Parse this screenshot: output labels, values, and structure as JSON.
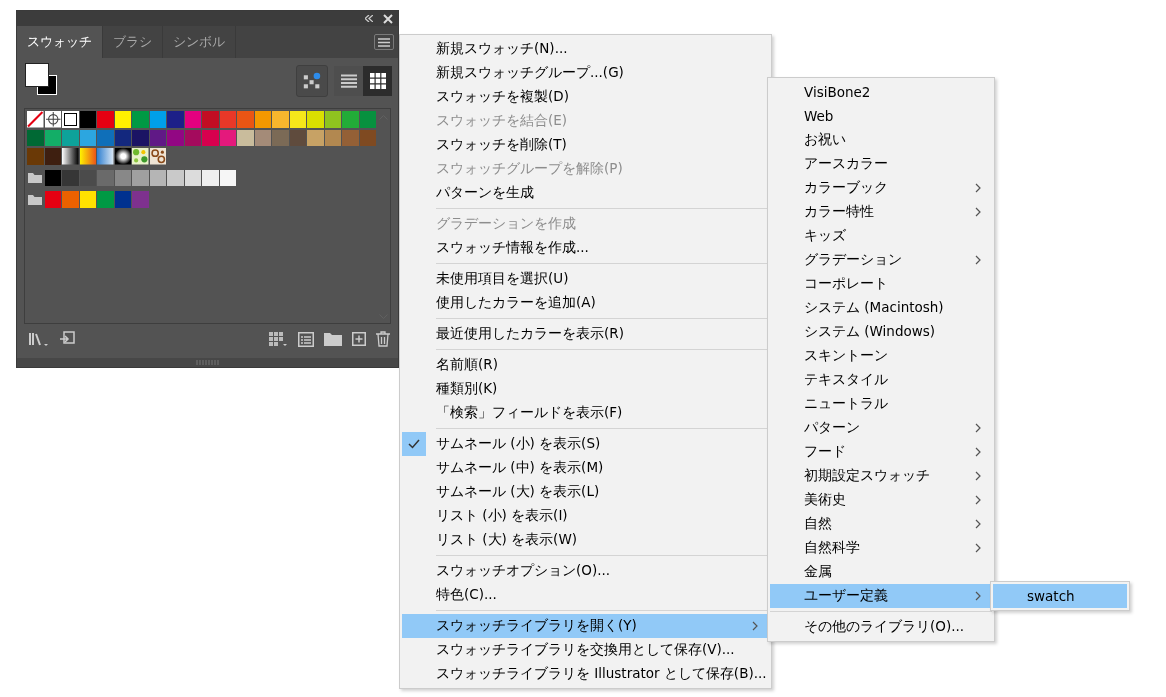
{
  "panel": {
    "tabs": [
      {
        "label": "スウォッチ",
        "selected": true
      },
      {
        "label": "ブラシ",
        "selected": false
      },
      {
        "label": "シンボル",
        "selected": false
      }
    ],
    "view_buttons": [
      {
        "kind": "list",
        "selected": false
      },
      {
        "kind": "grid",
        "selected": true
      }
    ],
    "swatch_rows": [
      {
        "kind": "plain",
        "swatches": [
          {
            "kind": "none"
          },
          {
            "kind": "registration"
          },
          {
            "kind": "solid",
            "color": "#ffffff"
          },
          {
            "kind": "solid",
            "color": "#000000"
          },
          {
            "kind": "solid",
            "color": "#e60012"
          },
          {
            "kind": "solid",
            "color": "#fff100"
          },
          {
            "kind": "solid",
            "color": "#009944"
          },
          {
            "kind": "solid",
            "color": "#00a0e9"
          },
          {
            "kind": "solid",
            "color": "#1d2088"
          },
          {
            "kind": "solid",
            "color": "#e4007f"
          },
          {
            "kind": "solid",
            "color": "#c30d23"
          },
          {
            "kind": "solid",
            "color": "#e83828"
          },
          {
            "kind": "solid",
            "color": "#ea5514"
          },
          {
            "kind": "solid",
            "color": "#f39800"
          },
          {
            "kind": "solid",
            "color": "#f8b62d"
          },
          {
            "kind": "solid",
            "color": "#f5e71a"
          },
          {
            "kind": "solid",
            "color": "#dadf00"
          },
          {
            "kind": "solid",
            "color": "#8fc31f"
          },
          {
            "kind": "solid",
            "color": "#22ac38"
          },
          {
            "kind": "solid",
            "color": "#07913f"
          }
        ]
      },
      {
        "kind": "plain",
        "swatches": [
          {
            "kind": "solid",
            "color": "#006934"
          },
          {
            "kind": "solid",
            "color": "#13ae67"
          },
          {
            "kind": "solid",
            "color": "#0ea29a"
          },
          {
            "kind": "solid",
            "color": "#2ca6e0"
          },
          {
            "kind": "solid",
            "color": "#0f6fb9"
          },
          {
            "kind": "solid",
            "color": "#13287e"
          },
          {
            "kind": "solid",
            "color": "#1b1464"
          },
          {
            "kind": "solid",
            "color": "#601986"
          },
          {
            "kind": "solid",
            "color": "#920783"
          },
          {
            "kind": "solid",
            "color": "#a40b5d"
          },
          {
            "kind": "solid",
            "color": "#d7004e"
          },
          {
            "kind": "solid",
            "color": "#e4197c"
          },
          {
            "kind": "solid",
            "color": "#c9bc9c"
          },
          {
            "kind": "solid",
            "color": "#a48b78"
          },
          {
            "kind": "solid",
            "color": "#7b6a56"
          },
          {
            "kind": "solid",
            "color": "#5f4b3d"
          },
          {
            "kind": "solid",
            "color": "#c7a265"
          },
          {
            "kind": "solid",
            "color": "#b28850"
          },
          {
            "kind": "solid",
            "color": "#946036"
          },
          {
            "kind": "solid",
            "color": "#7f4a21"
          }
        ]
      },
      {
        "kind": "plain",
        "swatches": [
          {
            "kind": "solid",
            "color": "#6a3906"
          },
          {
            "kind": "solid",
            "color": "#3e1f10"
          },
          {
            "kind": "gradient-gray"
          },
          {
            "kind": "gradient-warm"
          },
          {
            "kind": "gradient-fade"
          },
          {
            "kind": "gradient-radial"
          },
          {
            "kind": "pattern-leaf"
          },
          {
            "kind": "pattern-swirl"
          }
        ]
      },
      {
        "kind": "group",
        "swatches": [
          {
            "kind": "solid",
            "color": "#000000"
          },
          {
            "kind": "solid",
            "color": "#363636"
          },
          {
            "kind": "solid",
            "color": "#4b4b4b"
          },
          {
            "kind": "solid",
            "color": "#6a6a6a"
          },
          {
            "kind": "solid",
            "color": "#888888"
          },
          {
            "kind": "solid",
            "color": "#a0a0a0"
          },
          {
            "kind": "solid",
            "color": "#b5b5b5"
          },
          {
            "kind": "solid",
            "color": "#c9c9c9"
          },
          {
            "kind": "solid",
            "color": "#dcdcdc"
          },
          {
            "kind": "solid",
            "color": "#efefef"
          },
          {
            "kind": "solid",
            "color": "#f6f6f6"
          }
        ]
      },
      {
        "kind": "group",
        "swatches": [
          {
            "kind": "solid",
            "color": "#e60012"
          },
          {
            "kind": "solid",
            "color": "#eb6100"
          },
          {
            "kind": "solid",
            "color": "#ffe100"
          },
          {
            "kind": "solid",
            "color": "#009944"
          },
          {
            "kind": "solid",
            "color": "#00318f"
          },
          {
            "kind": "solid",
            "color": "#7e318e"
          }
        ]
      }
    ]
  },
  "menu": [
    {
      "kind": "item",
      "label": "新規スウォッチ(N)...",
      "disabled": false,
      "checked": false,
      "selected": false,
      "has_submenu": false
    },
    {
      "kind": "item",
      "label": "新規スウォッチグループ...(G)",
      "disabled": false,
      "checked": false,
      "selected": false,
      "has_submenu": false
    },
    {
      "kind": "item",
      "label": "スウォッチを複製(D)",
      "disabled": false,
      "checked": false,
      "selected": false,
      "has_submenu": false
    },
    {
      "kind": "item",
      "label": "スウォッチを結合(E)",
      "disabled": true,
      "checked": false,
      "selected": false,
      "has_submenu": false
    },
    {
      "kind": "item",
      "label": "スウォッチを削除(T)",
      "disabled": false,
      "checked": false,
      "selected": false,
      "has_submenu": false
    },
    {
      "kind": "item",
      "label": "スウォッチグループを解除(P)",
      "disabled": true,
      "checked": false,
      "selected": false,
      "has_submenu": false
    },
    {
      "kind": "item",
      "label": "パターンを生成",
      "disabled": false,
      "checked": false,
      "selected": false,
      "has_submenu": false
    },
    {
      "kind": "separator"
    },
    {
      "kind": "item",
      "label": "グラデーションを作成",
      "disabled": true,
      "checked": false,
      "selected": false,
      "has_submenu": false
    },
    {
      "kind": "item",
      "label": "スウォッチ情報を作成...",
      "disabled": false,
      "checked": false,
      "selected": false,
      "has_submenu": false
    },
    {
      "kind": "separator"
    },
    {
      "kind": "item",
      "label": "未使用項目を選択(U)",
      "disabled": false,
      "checked": false,
      "selected": false,
      "has_submenu": false
    },
    {
      "kind": "item",
      "label": "使用したカラーを追加(A)",
      "disabled": false,
      "checked": false,
      "selected": false,
      "has_submenu": false
    },
    {
      "kind": "separator"
    },
    {
      "kind": "item",
      "label": "最近使用したカラーを表示(R)",
      "disabled": false,
      "checked": false,
      "selected": false,
      "has_submenu": false
    },
    {
      "kind": "separator"
    },
    {
      "kind": "item",
      "label": "名前順(R)",
      "disabled": false,
      "checked": false,
      "selected": false,
      "has_submenu": false
    },
    {
      "kind": "item",
      "label": "種類別(K)",
      "disabled": false,
      "checked": false,
      "selected": false,
      "has_submenu": false
    },
    {
      "kind": "item",
      "label": "「検索」フィールドを表示(F)",
      "disabled": false,
      "checked": false,
      "selected": false,
      "has_submenu": false
    },
    {
      "kind": "separator"
    },
    {
      "kind": "item",
      "label": "サムネール (小) を表示(S)",
      "disabled": false,
      "checked": true,
      "selected": false,
      "has_submenu": false
    },
    {
      "kind": "item",
      "label": "サムネール (中) を表示(M)",
      "disabled": false,
      "checked": false,
      "selected": false,
      "has_submenu": false
    },
    {
      "kind": "item",
      "label": "サムネール (大) を表示(L)",
      "disabled": false,
      "checked": false,
      "selected": false,
      "has_submenu": false
    },
    {
      "kind": "item",
      "label": "リスト (小) を表示(I)",
      "disabled": false,
      "checked": false,
      "selected": false,
      "has_submenu": false
    },
    {
      "kind": "item",
      "label": "リスト (大) を表示(W)",
      "disabled": false,
      "checked": false,
      "selected": false,
      "has_submenu": false
    },
    {
      "kind": "separator"
    },
    {
      "kind": "item",
      "label": "スウォッチオプション(O)...",
      "disabled": false,
      "checked": false,
      "selected": false,
      "has_submenu": false
    },
    {
      "kind": "item",
      "label": "特色(C)...",
      "disabled": false,
      "checked": false,
      "selected": false,
      "has_submenu": false
    },
    {
      "kind": "separator"
    },
    {
      "kind": "item",
      "label": "スウォッチライブラリを開く(Y)",
      "disabled": false,
      "checked": false,
      "selected": true,
      "has_submenu": true
    },
    {
      "kind": "item",
      "label": "スウォッチライブラリを交換用として保存(V)...",
      "disabled": false,
      "checked": false,
      "selected": false,
      "has_submenu": false
    },
    {
      "kind": "item",
      "label": "スウォッチライブラリを Illustrator として保存(B)...",
      "disabled": false,
      "checked": false,
      "selected": false,
      "has_submenu": false
    }
  ],
  "submenu": [
    {
      "kind": "item",
      "label": "VisiBone2",
      "selected": false,
      "has_submenu": false
    },
    {
      "kind": "item",
      "label": "Web",
      "selected": false,
      "has_submenu": false
    },
    {
      "kind": "item",
      "label": "お祝い",
      "selected": false,
      "has_submenu": false
    },
    {
      "kind": "item",
      "label": "アースカラー",
      "selected": false,
      "has_submenu": false
    },
    {
      "kind": "item",
      "label": "カラーブック",
      "selected": false,
      "has_submenu": true
    },
    {
      "kind": "item",
      "label": "カラー特性",
      "selected": false,
      "has_submenu": true
    },
    {
      "kind": "item",
      "label": "キッズ",
      "selected": false,
      "has_submenu": false
    },
    {
      "kind": "item",
      "label": "グラデーション",
      "selected": false,
      "has_submenu": true
    },
    {
      "kind": "item",
      "label": "コーポレート",
      "selected": false,
      "has_submenu": false
    },
    {
      "kind": "item",
      "label": "システム (Macintosh)",
      "selected": false,
      "has_submenu": false
    },
    {
      "kind": "item",
      "label": "システム (Windows)",
      "selected": false,
      "has_submenu": false
    },
    {
      "kind": "item",
      "label": "スキントーン",
      "selected": false,
      "has_submenu": false
    },
    {
      "kind": "item",
      "label": "テキスタイル",
      "selected": false,
      "has_submenu": false
    },
    {
      "kind": "item",
      "label": "ニュートラル",
      "selected": false,
      "has_submenu": false
    },
    {
      "kind": "item",
      "label": "パターン",
      "selected": false,
      "has_submenu": true
    },
    {
      "kind": "item",
      "label": "フード",
      "selected": false,
      "has_submenu": true
    },
    {
      "kind": "item",
      "label": "初期設定スウォッチ",
      "selected": false,
      "has_submenu": true
    },
    {
      "kind": "item",
      "label": "美術史",
      "selected": false,
      "has_submenu": true
    },
    {
      "kind": "item",
      "label": "自然",
      "selected": false,
      "has_submenu": true
    },
    {
      "kind": "item",
      "label": "自然科学",
      "selected": false,
      "has_submenu": true
    },
    {
      "kind": "item",
      "label": "金属",
      "selected": false,
      "has_submenu": false
    },
    {
      "kind": "item",
      "label": "ユーザー定義",
      "selected": true,
      "has_submenu": true
    },
    {
      "kind": "separator"
    },
    {
      "kind": "item",
      "label": "その他のライブラリ(O)...",
      "selected": false,
      "has_submenu": false
    }
  ],
  "user_submenu": [
    {
      "kind": "item",
      "label": "swatch",
      "selected": true,
      "has_submenu": false
    }
  ]
}
